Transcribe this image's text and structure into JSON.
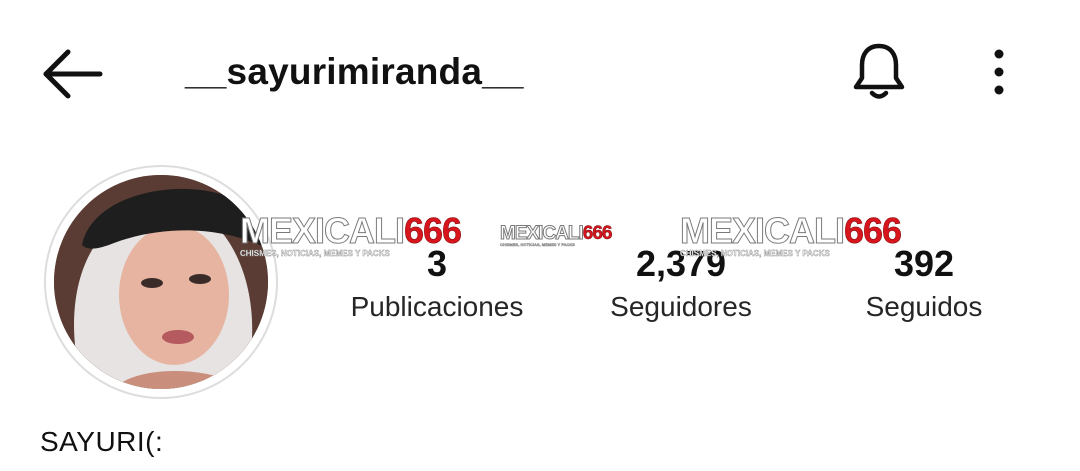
{
  "header": {
    "username": "__sayurimiranda__",
    "back_icon": "arrow-left-icon",
    "bell_icon": "bell-icon",
    "more_icon": "more-vertical-icon"
  },
  "profile": {
    "avatar_icon": "profile-photo",
    "display_name": "SAYURI(:"
  },
  "stats": [
    {
      "value": "3",
      "label": "Publicaciones"
    },
    {
      "value": "2,379",
      "label": "Seguidores"
    },
    {
      "value": "392",
      "label": "Seguidos"
    }
  ],
  "watermark": {
    "title_part1": "MEXICALI",
    "title_part2": "666",
    "subtitle": "CHISMES, NOTICIAS, MEMES Y PACKS"
  },
  "colors": {
    "background": "#ffffff",
    "text": "#111111",
    "watermark_red": "#d6151d"
  }
}
